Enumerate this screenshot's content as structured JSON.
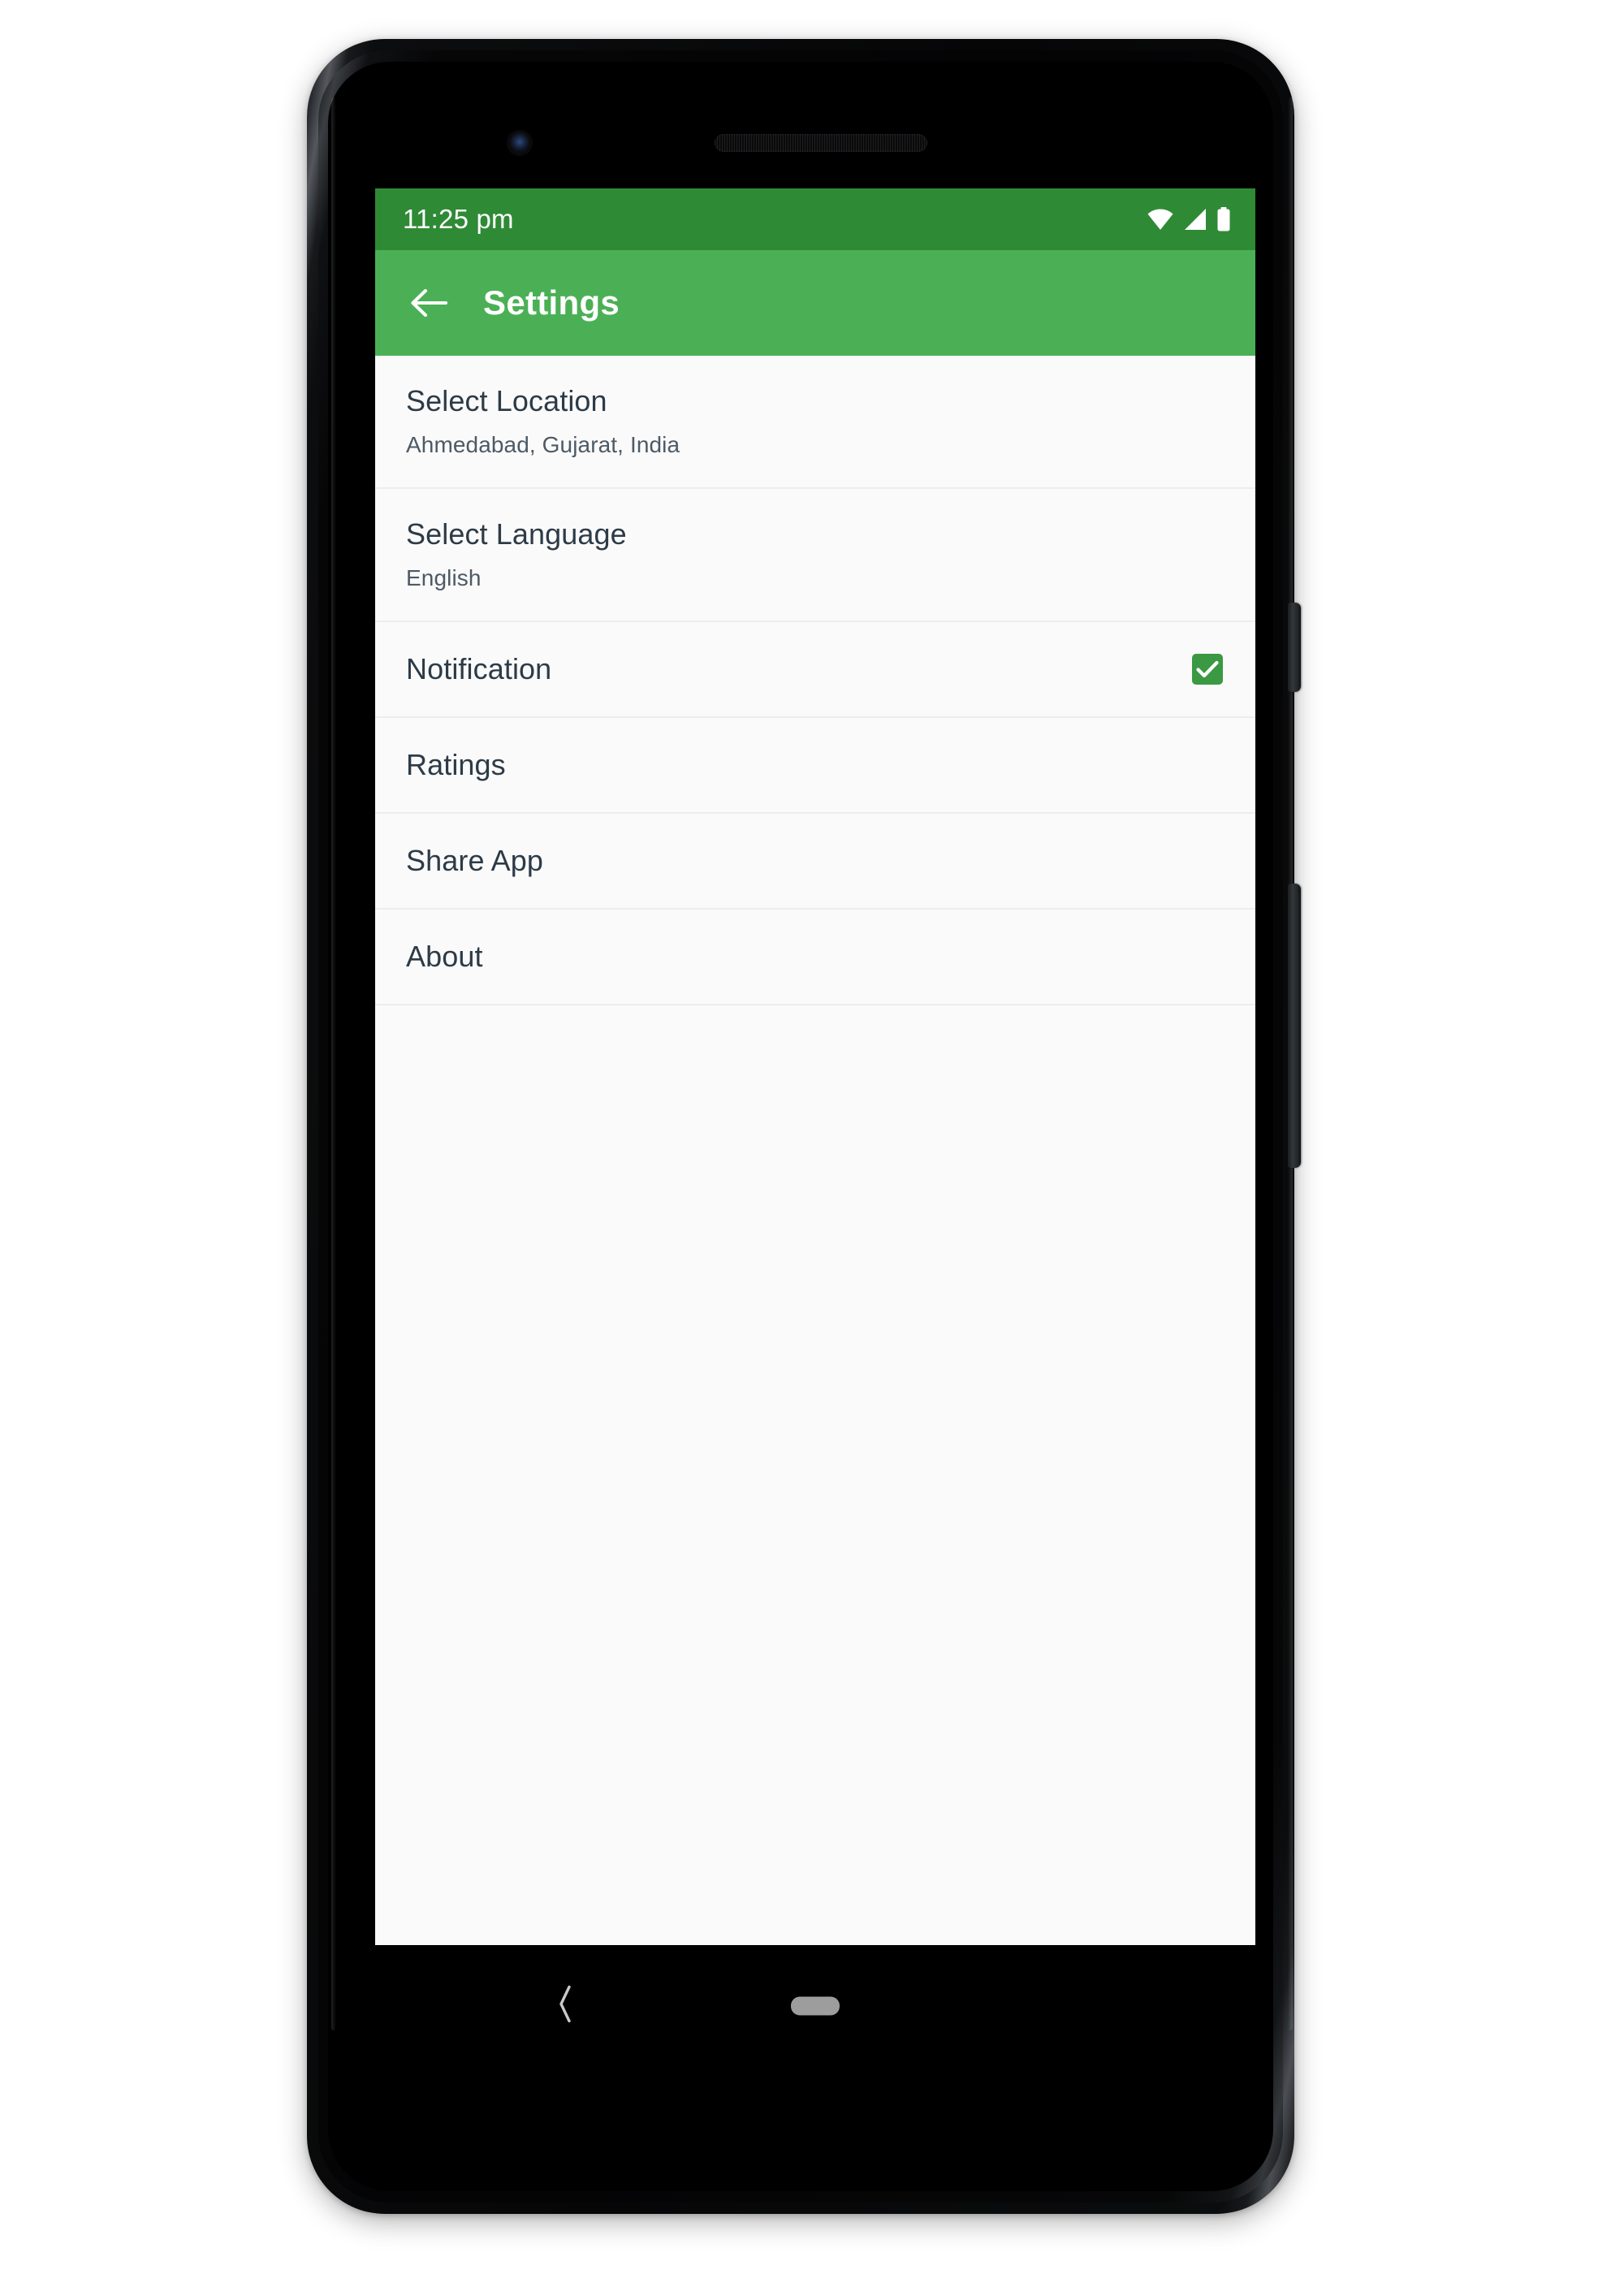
{
  "device": {
    "name": "android-phone",
    "sensors": {
      "front_camera": "front-camera-icon",
      "earpiece": "earpiece-speaker-icon"
    },
    "buttons": {
      "power": "power-button",
      "volume": "volume-rocker-button"
    }
  },
  "colors": {
    "status_bar_green": "#2f8a36",
    "app_bar_green": "#4bb055",
    "checkbox_green": "#3a9942",
    "list_background": "#fafafa",
    "divider": "#eceded",
    "title_text": "#2d3b47",
    "subtitle_text": "#4d5a66",
    "nav_bar": "#000000",
    "nav_handle": "#9d9d9d"
  },
  "status_bar": {
    "time": "11:25 pm",
    "icons": [
      "wifi-icon",
      "cellular-signal-icon",
      "battery-icon"
    ]
  },
  "app_bar": {
    "back_icon": "back-arrow-icon",
    "title": "Settings"
  },
  "settings": {
    "rows": [
      {
        "id": "select-location",
        "title": "Select Location",
        "subtitle": "Ahmedabad, Gujarat, India",
        "type": "two-line"
      },
      {
        "id": "select-language",
        "title": "Select Language",
        "subtitle": "English",
        "type": "two-line"
      },
      {
        "id": "notification",
        "title": "Notification",
        "subtitle": "",
        "type": "one-line-checkbox",
        "checked": true
      },
      {
        "id": "ratings",
        "title": "Ratings",
        "subtitle": "",
        "type": "one-line"
      },
      {
        "id": "share-app",
        "title": "Share App",
        "subtitle": "",
        "type": "one-line"
      },
      {
        "id": "about",
        "title": "About",
        "subtitle": "",
        "type": "one-line"
      }
    ]
  },
  "system_nav": {
    "back_icon": "nav-back-chevron-icon",
    "home_handle": "nav-home-handle"
  }
}
